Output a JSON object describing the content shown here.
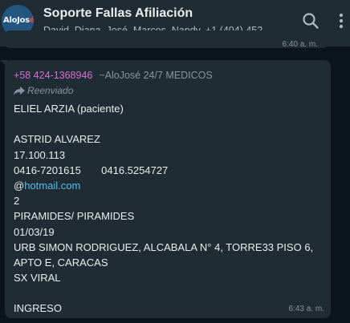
{
  "header": {
    "title": "Soporte Fallas Afiliación",
    "participants": "David, Diana, José, Marcos, Nandy, +1 (404) 452-...",
    "avatar": {
      "text_main": "AloJos",
      "text_accent": "é"
    }
  },
  "previous_message": {
    "time": "6:40 a. m."
  },
  "message": {
    "sender_phone": "+58 424-1368946",
    "sender_name": "~AloJosé 24/7 MEDICOS",
    "forwarded_label": "Reenviado",
    "lines": [
      "ELIEL ARZIA (paciente)",
      "",
      "ASTRID ALVAREZ",
      "17.100.113",
      "0416-7201615       0416.5254727",
      "",
      "2",
      "PIRAMIDES/ PIRAMIDES",
      "01/03/19",
      "URB SIMON RODRIGUEZ, ALCABALA N° 4, TORRE33 PISO 6,",
      "APTO E, CARACAS",
      "SX VIRAL",
      "",
      "INGRESO"
    ],
    "email_prefix": "@",
    "email_link": "hotmail.com",
    "time": "6:43 a. m."
  },
  "colors": {
    "background": "#0b141a",
    "header": "#1f2c33",
    "bubble": "#202c33",
    "sender_phone": "#d76fd2",
    "link": "#53bdeb"
  },
  "icons": [
    "search-icon",
    "more-vertical-icon",
    "forward-icon"
  ]
}
